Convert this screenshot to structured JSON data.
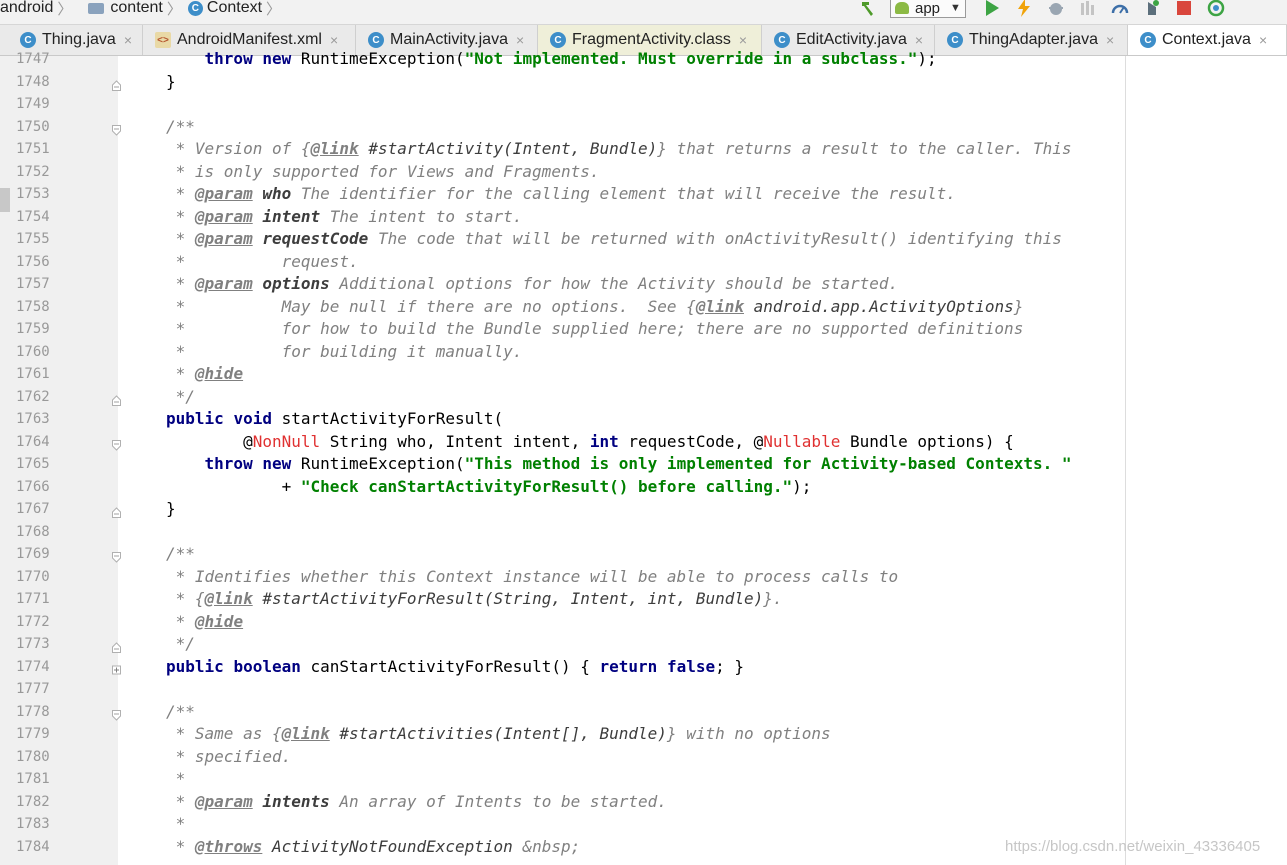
{
  "breadcrumb": [
    "android",
    "content",
    "Context"
  ],
  "toolbar": {
    "run_config": "app"
  },
  "tabs": [
    {
      "label": "Thing.java",
      "icon": "class-icon"
    },
    {
      "label": "AndroidManifest.xml",
      "icon": "xml-icon"
    },
    {
      "label": "MainActivity.java",
      "icon": "class-icon"
    },
    {
      "label": "FragmentActivity.class",
      "icon": "class-icon"
    },
    {
      "label": "EditActivity.java",
      "icon": "class-icon"
    },
    {
      "label": "ThingAdapter.java",
      "icon": "class-icon"
    },
    {
      "label": "Context.java",
      "icon": "class-icon"
    }
  ],
  "lines": [
    {
      "n": "1747",
      "code": "        throw new RuntimeException(\"Not implemented. Must override in a subclass.\");"
    },
    {
      "n": "1748",
      "code": "    }"
    },
    {
      "n": "1749",
      "code": ""
    },
    {
      "n": "1750",
      "code": "    /**"
    },
    {
      "n": "1751",
      "code": "     * Version of {@link #startActivity(Intent, Bundle)} that returns a result to the caller. This"
    },
    {
      "n": "1752",
      "code": "     * is only supported for Views and Fragments."
    },
    {
      "n": "1753",
      "code": "     * @param who The identifier for the calling element that will receive the result."
    },
    {
      "n": "1754",
      "code": "     * @param intent The intent to start."
    },
    {
      "n": "1755",
      "code": "     * @param requestCode The code that will be returned with onActivityResult() identifying this"
    },
    {
      "n": "1756",
      "code": "     *          request."
    },
    {
      "n": "1757",
      "code": "     * @param options Additional options for how the Activity should be started."
    },
    {
      "n": "1758",
      "code": "     *          May be null if there are no options.  See {@link android.app.ActivityOptions}"
    },
    {
      "n": "1759",
      "code": "     *          for how to build the Bundle supplied here; there are no supported definitions"
    },
    {
      "n": "1760",
      "code": "     *          for building it manually."
    },
    {
      "n": "1761",
      "code": "     * @hide"
    },
    {
      "n": "1762",
      "code": "     */"
    },
    {
      "n": "1763",
      "code": "    public void startActivityForResult("
    },
    {
      "n": "1764",
      "code": "            @NonNull String who, Intent intent, int requestCode, @Nullable Bundle options) {"
    },
    {
      "n": "1765",
      "code": "        throw new RuntimeException(\"This method is only implemented for Activity-based Contexts. \""
    },
    {
      "n": "1766",
      "code": "                + \"Check canStartActivityForResult() before calling.\");"
    },
    {
      "n": "1767",
      "code": "    }"
    },
    {
      "n": "1768",
      "code": ""
    },
    {
      "n": "1769",
      "code": "    /**"
    },
    {
      "n": "1770",
      "code": "     * Identifies whether this Context instance will be able to process calls to"
    },
    {
      "n": "1771",
      "code": "     * {@link #startActivityForResult(String, Intent, int, Bundle)}."
    },
    {
      "n": "1772",
      "code": "     * @hide"
    },
    {
      "n": "1773",
      "code": "     */"
    },
    {
      "n": "1774",
      "code": "    public boolean canStartActivityForResult() { return false; }"
    },
    {
      "n": "1777",
      "code": ""
    },
    {
      "n": "1778",
      "code": "    /**"
    },
    {
      "n": "1779",
      "code": "     * Same as {@link #startActivities(Intent[], Bundle)} with no options"
    },
    {
      "n": "1780",
      "code": "     * specified."
    },
    {
      "n": "1781",
      "code": "     *"
    },
    {
      "n": "1782",
      "code": "     * @param intents An array of Intents to be started."
    },
    {
      "n": "1783",
      "code": "     *"
    },
    {
      "n": "1784",
      "code": "     * @throws ActivityNotFoundException &nbsp;"
    }
  ],
  "watermark": "https://blog.csdn.net/weixin_43336405"
}
